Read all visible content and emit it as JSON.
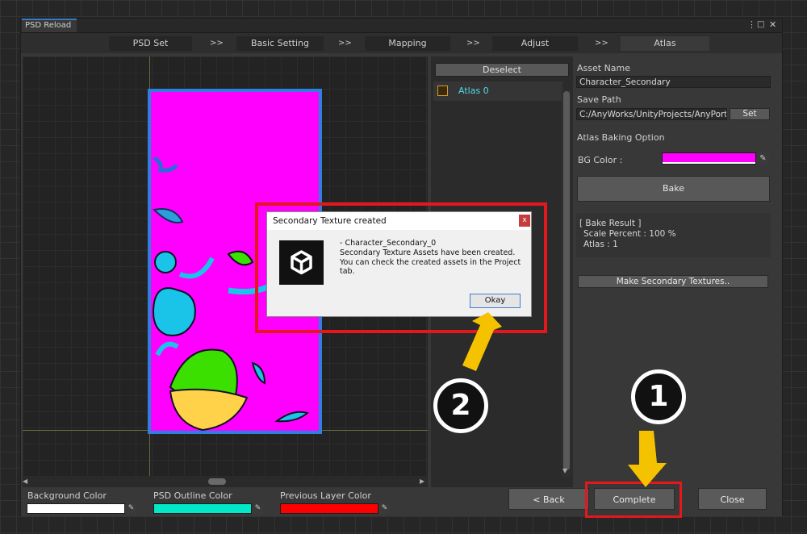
{
  "window": {
    "tab_title": "PSD Reload",
    "menu_icon": "⋮",
    "maximize_icon": "□",
    "close_icon": "✕"
  },
  "steps": {
    "items": [
      "PSD Set",
      "Basic Setting",
      "Mapping",
      "Adjust",
      "Atlas"
    ],
    "separator": ">>",
    "active": "Atlas"
  },
  "list": {
    "deselect_label": "Deselect",
    "atlas_item_label": "Atlas 0"
  },
  "settings": {
    "asset_name_label": "Asset Name",
    "asset_name_value": "Character_Secondary",
    "save_path_label": "Save Path",
    "save_path_value": "C:/AnyWorks/UnityProjects/AnyPortra",
    "set_button": "Set",
    "atlas_baking_option_label": "Atlas Baking Option",
    "bg_color_label": "BG Color :",
    "bg_color_value": "#ff00ff",
    "bake_button": "Bake",
    "bake_result_title": "[ Bake Result ]",
    "bake_result_scale": "Scale Percent : 100 %",
    "bake_result_atlas": "Atlas : 1",
    "make_secondary_button": "Make Secondary Textures.."
  },
  "bottom": {
    "background_color_label": "Background Color",
    "background_color_value": "#ffffff",
    "psd_outline_color_label": "PSD Outline Color",
    "psd_outline_color_value": "#00e8c8",
    "previous_layer_color_label": "Previous Layer Color",
    "previous_layer_color_value": "#ff0000",
    "back_button": "< Back",
    "complete_button": "Complete",
    "close_button": "Close"
  },
  "dialog": {
    "title": "Secondary Texture created",
    "close_glyph": "x",
    "line1": "- Character_Secondary_0",
    "line2": "Secondary Texture Assets have been created.",
    "line3": "You can check the created assets in the Project tab.",
    "okay_button": "Okay"
  },
  "annotations": {
    "badge_1": "1",
    "badge_2": "2",
    "highlight_color": "#e4171d",
    "arrow_color": "#f5c200"
  },
  "preview": {
    "atlas_bg": "#ff00ff",
    "outline": "#2f7fe0"
  }
}
